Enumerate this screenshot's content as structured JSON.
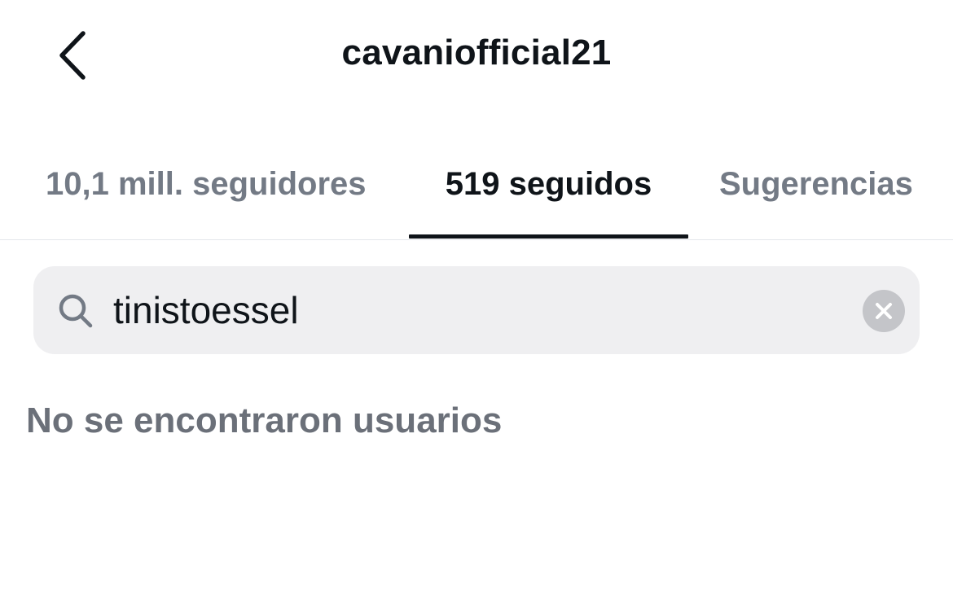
{
  "header": {
    "back_icon": "chevron-left-icon",
    "title": "cavaniofficial21"
  },
  "tabs": [
    {
      "label": "10,1 mill. seguidores",
      "active": false
    },
    {
      "label": "519 seguidos",
      "active": true
    },
    {
      "label": "Sugerencias",
      "active": false
    }
  ],
  "search": {
    "icon": "search-icon",
    "value": "tinistoessel",
    "clear_icon": "clear-icon"
  },
  "results": {
    "empty_message": "No se encontraron usuarios"
  },
  "colors": {
    "text_primary": "#0f1419",
    "text_secondary": "#737a85",
    "search_background": "#efeff1",
    "active_tab_indicator": "#0f1419"
  }
}
